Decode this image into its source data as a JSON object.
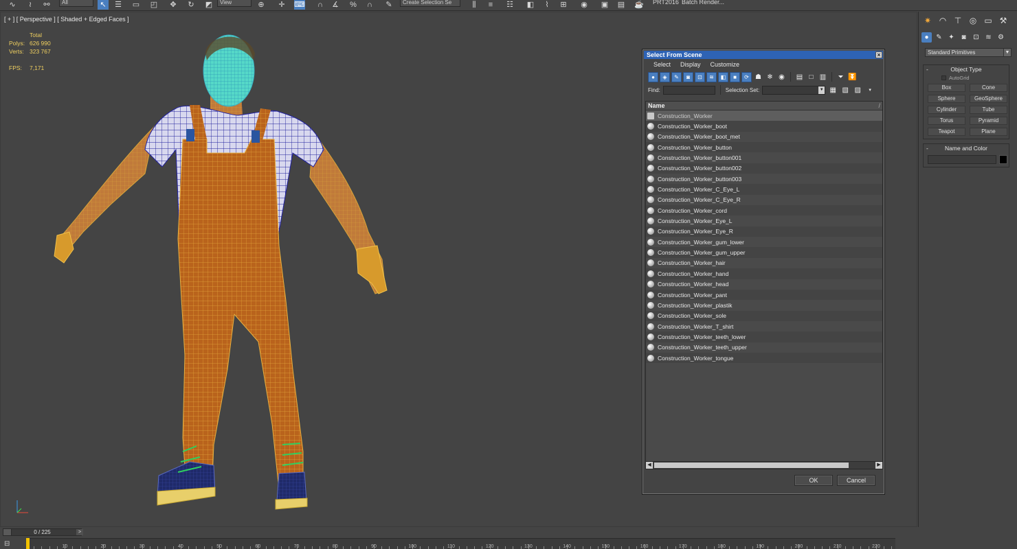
{
  "toolbar": {
    "filter_dropdown": "All",
    "view_dropdown": "View",
    "selection_set": "Create Selection Se",
    "prt_label": "PRT2016",
    "batch_render": "Batch Render..."
  },
  "viewport": {
    "label": "[ + ] [ Perspective ] [ Shaded + Edged Faces ]",
    "stats_header": "Total",
    "polys_label": "Polys:",
    "polys_value": "626 990",
    "verts_label": "Verts:",
    "verts_value": "323 767",
    "fps_label": "FPS:",
    "fps_value": "7,171"
  },
  "command_panel": {
    "dropdown": "Standard Primitives",
    "object_type_title": "Object Type",
    "autogrid": "AutoGrid",
    "primitives": [
      "Box",
      "Cone",
      "Sphere",
      "GeoSphere",
      "Cylinder",
      "Tube",
      "Torus",
      "Pyramid",
      "Teapot",
      "Plane"
    ],
    "name_color_title": "Name and Color"
  },
  "timeline": {
    "slider_text": "0 / 225",
    "ticks": [
      10,
      20,
      30,
      40,
      50,
      60,
      70,
      80,
      90,
      100,
      110,
      120,
      130,
      140,
      150,
      160,
      170,
      180,
      190,
      200,
      210,
      220
    ]
  },
  "dialog": {
    "title": "Select From Scene",
    "menu": [
      "Select",
      "Display",
      "Customize"
    ],
    "find_label": "Find:",
    "selection_set_label": "Selection Set:",
    "column_name": "Name",
    "items": [
      "Construction_Worker",
      "Construction_Worker_boot",
      "Construction_Worker_boot_met",
      "Construction_Worker_button",
      "Construction_Worker_button001",
      "Construction_Worker_button002",
      "Construction_Worker_button003",
      "Construction_Worker_C_Eye_L",
      "Construction_Worker_C_Eye_R",
      "Construction_Worker_cord",
      "Construction_Worker_Eye_L",
      "Construction_Worker_Eye_R",
      "Construction_Worker_gum_lower",
      "Construction_Worker_gum_upper",
      "Construction_Worker_hair",
      "Construction_Worker_hand",
      "Construction_Worker_head",
      "Construction_Worker_pant",
      "Construction_Worker_plastik",
      "Construction_Worker_sole",
      "Construction_Worker_T_shirt",
      "Construction_Worker_teeth_lower",
      "Construction_Worker_teeth_upper",
      "Construction_Worker_tongue"
    ],
    "ok": "OK",
    "cancel": "Cancel"
  }
}
